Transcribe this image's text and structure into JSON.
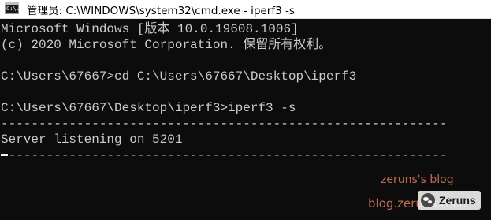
{
  "window": {
    "icon_text": "C:\\.",
    "title": "管理员: C:\\WINDOWS\\system32\\cmd.exe - iperf3  -s"
  },
  "console": {
    "lines": [
      "Microsoft Windows [版本 10.0.19608.1006]",
      "(c) 2020 Microsoft Corporation. 保留所有权利。",
      "",
      "C:\\Users\\67667>cd C:\\Users\\67667\\Desktop\\iperf3",
      "",
      "C:\\Users\\67667\\Desktop\\iperf3>iperf3 -s",
      "-----------------------------------------------------------",
      "Server listening on 5201",
      "-----------------------------------------------------------"
    ]
  },
  "watermark": {
    "blog_title": "zeruns's blog",
    "site": "blog.zeruns.tech",
    "brand": "Zeruns"
  },
  "colors": {
    "console_bg": "#0c0c0c",
    "console_text": "#cccccc",
    "titlebar_bg": "#ffffff",
    "watermark": "#e07a62"
  },
  "icons": {
    "app": "cmd-icon",
    "brand": "wechat-icon"
  }
}
